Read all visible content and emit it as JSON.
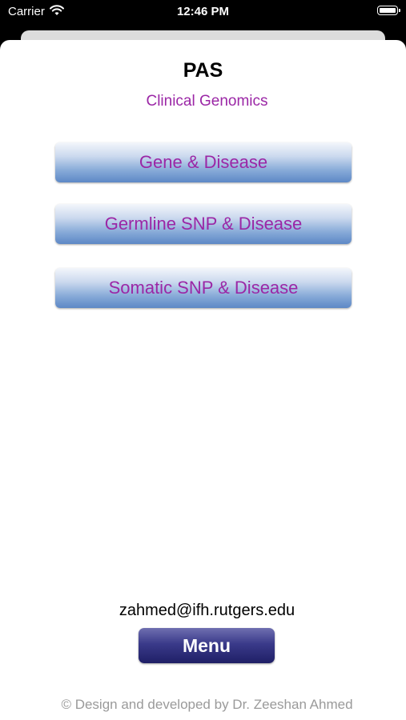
{
  "status_bar": {
    "carrier": "Carrier",
    "time": "12:46 PM",
    "wifi_icon": "wifi-icon",
    "battery_icon": "battery-icon"
  },
  "header": {
    "title": "PAS",
    "subtitle": "Clinical Genomics"
  },
  "buttons": [
    {
      "label": "Gene & Disease"
    },
    {
      "label": "Germline SNP & Disease"
    },
    {
      "label": "Somatic SNP & Disease"
    }
  ],
  "footer": {
    "email": "zahmed@ifh.rutgers.edu",
    "menu_label": "Menu",
    "copyright": "© Design and developed by Dr. Zeeshan Ahmed"
  },
  "colors": {
    "accent_text": "#9b27a6",
    "button_blue": "#5d88c6",
    "menu_navy": "#1f1f66"
  }
}
